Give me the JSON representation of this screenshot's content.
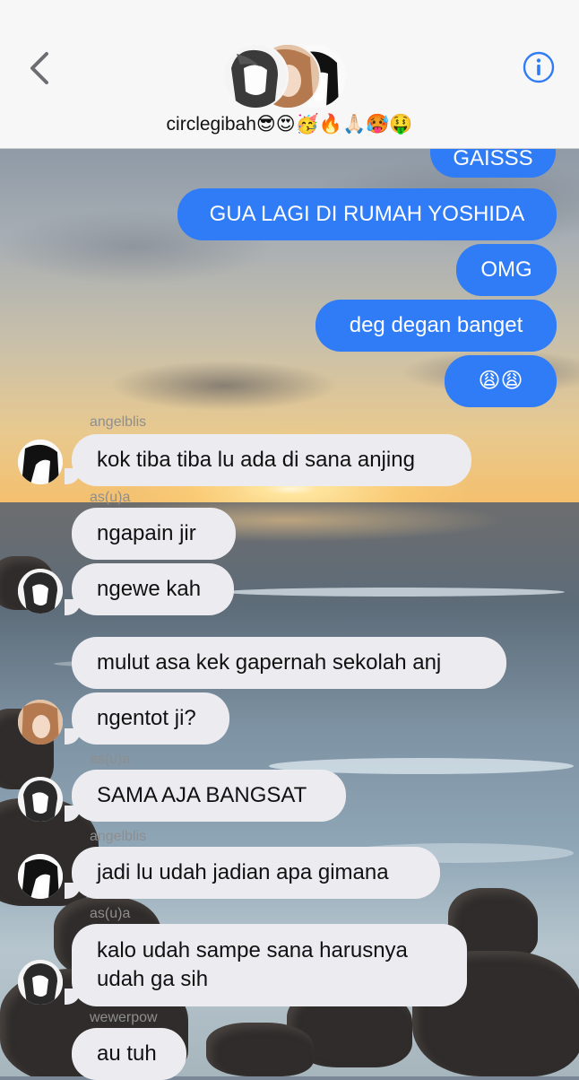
{
  "header": {
    "group_name": "circlegibah😎😍🥳🔥🙏🏻🥵🤑",
    "back_icon": "chevron-left-icon",
    "info_icon": "info-icon"
  },
  "colors": {
    "outgoing_bubble": "#2f7cf6",
    "incoming_bubble": "#ececf0",
    "accent": "#2f7cf6"
  },
  "messages": [
    {
      "direction": "out",
      "text": "GAISSS"
    },
    {
      "direction": "out",
      "text": "GUA LAGI DI RUMAH YOSHIDA"
    },
    {
      "direction": "out",
      "text": "OMG"
    },
    {
      "direction": "out",
      "text": "deg degan banget"
    },
    {
      "direction": "out",
      "text": "😩😩"
    },
    {
      "direction": "in",
      "sender": "angelblis",
      "text": "kok tiba tiba lu ada di sana anjing"
    },
    {
      "direction": "in",
      "sender": "as(u)a",
      "text": "ngapain jir"
    },
    {
      "direction": "in",
      "sender": "",
      "text": "ngewe kah"
    },
    {
      "direction": "in",
      "sender": "",
      "text": "mulut asa kek gapernah sekolah anj"
    },
    {
      "direction": "in",
      "sender": "",
      "text": "ngentot ji?"
    },
    {
      "direction": "in",
      "sender": "as(u)a",
      "text": "SAMA AJA BANGSAT"
    },
    {
      "direction": "in",
      "sender": "angelblis",
      "text": "jadi lu udah jadian apa gimana"
    },
    {
      "direction": "in",
      "sender": "as(u)a",
      "text_line1": "kalo udah sampe sana harusnya",
      "text_line2": "udah ga sih"
    },
    {
      "direction": "in",
      "sender": "wewerpow",
      "text": "au tuh"
    }
  ]
}
